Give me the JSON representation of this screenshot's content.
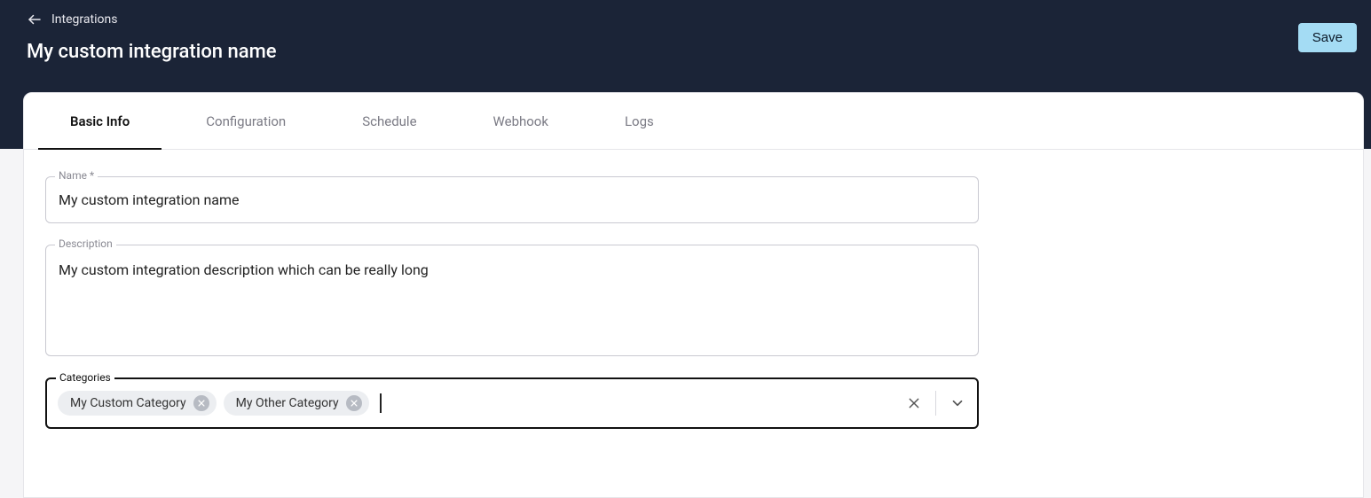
{
  "header": {
    "breadcrumb": "Integrations",
    "title": "My custom integration name",
    "save_label": "Save"
  },
  "tabs": [
    {
      "label": "Basic Info",
      "active": true
    },
    {
      "label": "Configuration",
      "active": false
    },
    {
      "label": "Schedule",
      "active": false
    },
    {
      "label": "Webhook",
      "active": false
    },
    {
      "label": "Logs",
      "active": false
    }
  ],
  "form": {
    "name": {
      "label": "Name *",
      "value": "My custom integration name"
    },
    "description": {
      "label": "Description",
      "value": "My custom integration description which can be really long"
    },
    "categories": {
      "label": "Categories",
      "chips": [
        {
          "label": "My Custom Category"
        },
        {
          "label": "My Other Category"
        }
      ]
    }
  }
}
